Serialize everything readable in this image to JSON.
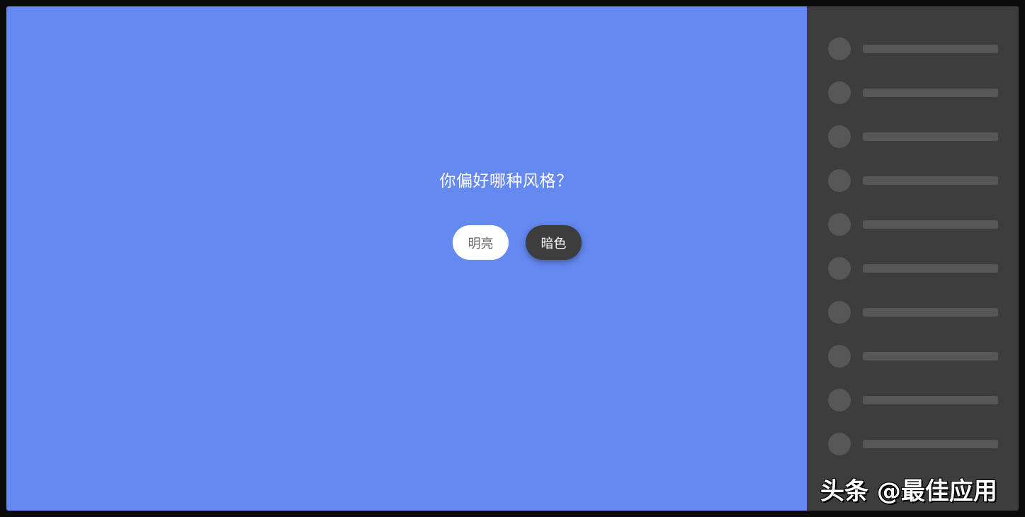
{
  "main": {
    "question": "你偏好哪种风格？",
    "options": {
      "light_label": "明亮",
      "dark_label": "暗色"
    }
  },
  "sidebar": {
    "skeleton_rows": 10
  },
  "watermark": "头条 @最佳应用",
  "colors": {
    "main_background": "#6489f1",
    "sidebar_background": "#3d3d3d",
    "skeleton": "#575757",
    "light_button": "#ffffff",
    "dark_button": "#3d3d3d"
  }
}
